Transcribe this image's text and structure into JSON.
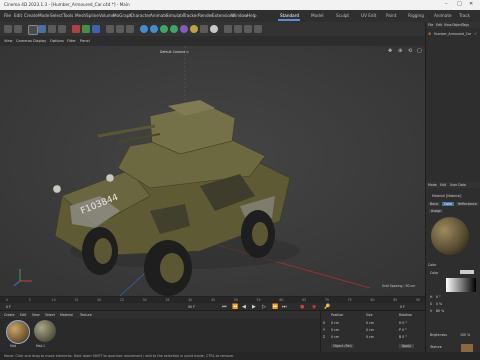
{
  "window": {
    "title": "Cinema 4D 2023.1.3 - [Humber_Armoured_Car.c4d *] - Main"
  },
  "menubar": {
    "items": [
      "File",
      "Edit",
      "Create",
      "Mode",
      "Select",
      "Tools",
      "Mesh",
      "Spline",
      "Volume",
      "MoGraph",
      "Character",
      "Animate",
      "Simulate",
      "Tracker",
      "Render",
      "Extensions",
      "Window",
      "Help"
    ],
    "layouts": [
      "Standard",
      "Model",
      "Sculpt",
      "UV Edit",
      "Paint",
      "Rigging",
      "Animate",
      "Track"
    ],
    "active_layout": "Standard"
  },
  "viewport": {
    "menu": [
      "View",
      "Cameras",
      "Display",
      "Options",
      "Filter",
      "Panel"
    ],
    "camera_label": "Default Camera ⊙",
    "grid_spacing": "Grid Spacing : 50 cm",
    "vehicle_number": "F103844"
  },
  "timeline": {
    "start": "0 F",
    "end": "90 F",
    "current": "0 F",
    "ticks": [
      "0",
      "5",
      "10",
      "15",
      "20",
      "25",
      "30",
      "35",
      "40",
      "45",
      "50",
      "55",
      "60",
      "65",
      "70",
      "75",
      "80",
      "85",
      "90"
    ]
  },
  "materials": {
    "menu": [
      "Create",
      "Edit",
      "View",
      "Select",
      "Material",
      "Texture"
    ],
    "items": [
      {
        "name": "Mat",
        "color": "#8a6a3c"
      },
      {
        "name": "Mat.1",
        "color": "#6f6a55"
      }
    ]
  },
  "coordinates": {
    "headers": [
      "Position",
      "Size",
      "Rotation"
    ],
    "rows": [
      {
        "axis": "X",
        "pos": "0 cm",
        "size": "0 cm",
        "rot": "H 0 °"
      },
      {
        "axis": "Y",
        "pos": "0 cm",
        "size": "0 cm",
        "rot": "P 0 °"
      },
      {
        "axis": "Z",
        "pos": "0 cm",
        "size": "0 cm",
        "rot": "B 0 °"
      }
    ],
    "mode": "Object (Rel)",
    "apply": "Apply"
  },
  "object_manager": {
    "menu": [
      "File",
      "Edit",
      "View",
      "Object",
      "Tags",
      "Bookmarks"
    ],
    "objects": [
      "Humber_Armoured_Car"
    ]
  },
  "attributes": {
    "menu": [
      "Mode",
      "Edit",
      "User Data"
    ],
    "title": "Material [Material]",
    "tabs": [
      "Basic",
      "Color",
      "Reflectance"
    ],
    "active_tab": "Color",
    "section_assign": "Assign",
    "section_color": "Color",
    "color_label": "Color",
    "rgb": [
      {
        "k": "H",
        "v": "0 °"
      },
      {
        "k": "S",
        "v": "0 %"
      },
      {
        "k": "V",
        "v": "80 %"
      }
    ],
    "brightness_label": "Brightness",
    "brightness_value": "100 %",
    "texture_label": "Texture",
    "texture_value": "Texture_Camo"
  },
  "status": {
    "text": "Move: Click and drag to move elements. Hold down SHIFT to quantize movement / add to the selection in point mode, CTRL to remove."
  }
}
